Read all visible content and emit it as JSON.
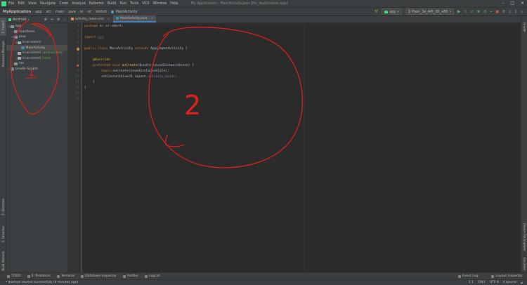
{
  "menubar": {
    "items": [
      "File",
      "Edit",
      "View",
      "Navigate",
      "Code",
      "Analyze",
      "Refactor",
      "Build",
      "Run",
      "Tools",
      "VCS",
      "Window",
      "Help"
    ],
    "window_title": "My Application - MainActivity.java [My_Application.app]"
  },
  "navbar": {
    "breadcrumbs": [
      "MyApplication",
      "app",
      "src",
      "main",
      "java",
      "kr",
      "or",
      "smhrd",
      "MainActivity"
    ],
    "run_config": "app",
    "device": "Pixel_3a_API_30_x86"
  },
  "project_panel": {
    "view_mode": "Android",
    "tree": [
      {
        "label": "app",
        "indent": 0,
        "arrow": "▾",
        "icon": "folder"
      },
      {
        "label": "manifests",
        "indent": 1,
        "arrow": "›",
        "icon": "folder"
      },
      {
        "label": "java",
        "indent": 1,
        "arrow": "▾",
        "icon": "folder-blue"
      },
      {
        "label": "kr.or.smhrd",
        "indent": 2,
        "arrow": "▾",
        "icon": "package"
      },
      {
        "label": "MainActivity",
        "indent": 3,
        "arrow": "",
        "icon": "class"
      },
      {
        "label": "kr.or.smhrd",
        "indent": 2,
        "arrow": "›",
        "icon": "package",
        "suffix": "(androidTest)",
        "suffix_style": "green"
      },
      {
        "label": "kr.or.smhrd",
        "indent": 2,
        "arrow": "›",
        "icon": "package",
        "suffix": "(test)",
        "suffix_style": "green"
      },
      {
        "label": "res",
        "indent": 1,
        "arrow": "›",
        "icon": "folder"
      },
      {
        "label": "Gradle Scripts",
        "indent": 0,
        "arrow": "›",
        "icon": "gradle"
      }
    ]
  },
  "left_stripe": {
    "top_tabs": [
      "1: Project",
      "Resource Manager"
    ],
    "bottom_tabs": [
      "Z: Structure",
      "2: Favorites",
      "Build Variants"
    ]
  },
  "right_stripe": {
    "top_tabs": [
      "Gradle"
    ],
    "bottom_tabs": [
      "Device File Explorer",
      "Emulator"
    ]
  },
  "editor": {
    "tabs": [
      {
        "label": "activity_main.xml",
        "active": false
      },
      {
        "label": "MainActivity.java",
        "active": true
      }
    ],
    "line_numbers": [
      "1",
      "2",
      "3",
      "4",
      "5",
      "6",
      "7",
      "8",
      "9",
      "10",
      "11",
      "12",
      "13",
      "14"
    ],
    "code": {
      "l1_kw": "package",
      "l1_rest": " kr.or.smhrd;",
      "l3_kw": "import",
      "l3_rest": "...",
      "l5_kw1": "public class",
      "l5_name": " MainActivity ",
      "l5_kw2": "extends",
      "l5_rest": " AppCompatActivity {",
      "l7_ann": "@Override",
      "l8_kw": "protected void",
      "l8_fn": " onCreate",
      "l8_rest": "(Bundle savedInstanceState) {",
      "l9_kw": "super",
      "l9_rest": ".onCreate(savedInstanceState);",
      "l10_pre": "setContentView(R.layout.",
      "l10_fld": "activity_main",
      "l10_post": ");",
      "l11": "}",
      "l12": "}"
    }
  },
  "bottom_tools": {
    "left": [
      "TODO",
      "6: Problems",
      "Terminal",
      "Database Inspector",
      "Profiler",
      "Logcat"
    ],
    "right": [
      "Event Log",
      "Layout Inspector"
    ]
  },
  "statusbar": {
    "message": "* daemon started successfully (4 minutes ago)",
    "position": "1:1",
    "line_sep": "CRLF",
    "encoding": "UTF-8",
    "indent": "4 spaces"
  },
  "annotations": {
    "mark_1": "1",
    "mark_2": "2",
    "color": "#e0201a"
  }
}
